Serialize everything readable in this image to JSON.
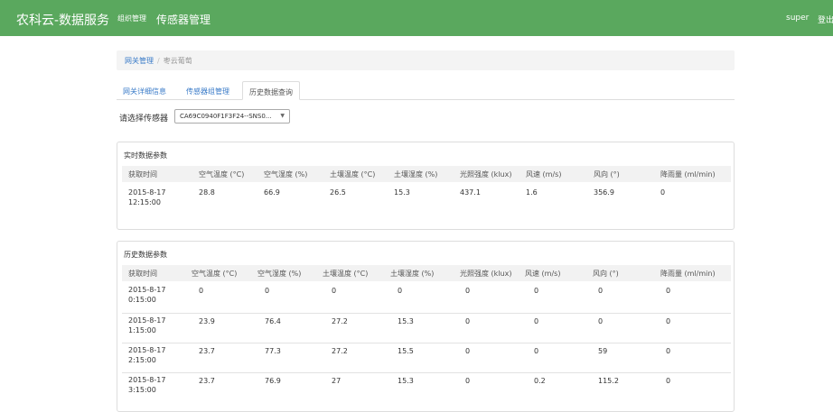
{
  "header": {
    "brand": "农科云-数据服务",
    "nav_org": "组织管理",
    "nav_sensor": "传感器管理",
    "user": "super",
    "logout": "登出"
  },
  "breadcrumb": {
    "link": "网关管理",
    "separator": "/",
    "current": "枣云葡萄"
  },
  "tabs": [
    "网关详细信息",
    "传感器组管理",
    "历史数据查询"
  ],
  "sensor": {
    "label": "请选择传感器",
    "selected": "CA69C0940F1F3F24--SNS0..."
  },
  "realtime": {
    "title": "实时数据参数",
    "headers": [
      "获取时间",
      "空气温度 (°C)",
      "空气湿度 (%)",
      "土壤温度 (°C)",
      "土壤湿度 (%)",
      "光照强度 (klux)",
      "风速 (m/s)",
      "风向 (°)",
      "降雨量 (ml/min)"
    ],
    "rows": [
      {
        "date": "2015-8-17",
        "time": "12:15:00",
        "values": [
          "28.8",
          "66.9",
          "26.5",
          "15.3",
          "437.1",
          "1.6",
          "356.9",
          "0"
        ]
      }
    ]
  },
  "history": {
    "title": "历史数据参数",
    "headers": [
      "获取时间",
      "空气温度 (°C)",
      "空气湿度 (%)",
      "土壤温度 (°C)",
      "土壤湿度 (%)",
      "光照强度 (klux)",
      "风速 (m/s)",
      "风向 (°)",
      "降雨量 (ml/min)"
    ],
    "rows": [
      {
        "date": "2015-8-17",
        "time": "0:15:00",
        "values": [
          "0",
          "0",
          "0",
          "0",
          "0",
          "0",
          "0",
          "0"
        ]
      },
      {
        "date": "2015-8-17",
        "time": "1:15:00",
        "values": [
          "23.9",
          "76.4",
          "27.2",
          "15.3",
          "0",
          "0",
          "0",
          "0"
        ]
      },
      {
        "date": "2015-8-17",
        "time": "2:15:00",
        "values": [
          "23.7",
          "77.3",
          "27.2",
          "15.5",
          "0",
          "0",
          "59",
          "0"
        ]
      },
      {
        "date": "2015-8-17",
        "time": "3:15:00",
        "values": [
          "23.7",
          "76.9",
          "27",
          "15.3",
          "0",
          "0.2",
          "115.2",
          "0"
        ]
      }
    ]
  }
}
